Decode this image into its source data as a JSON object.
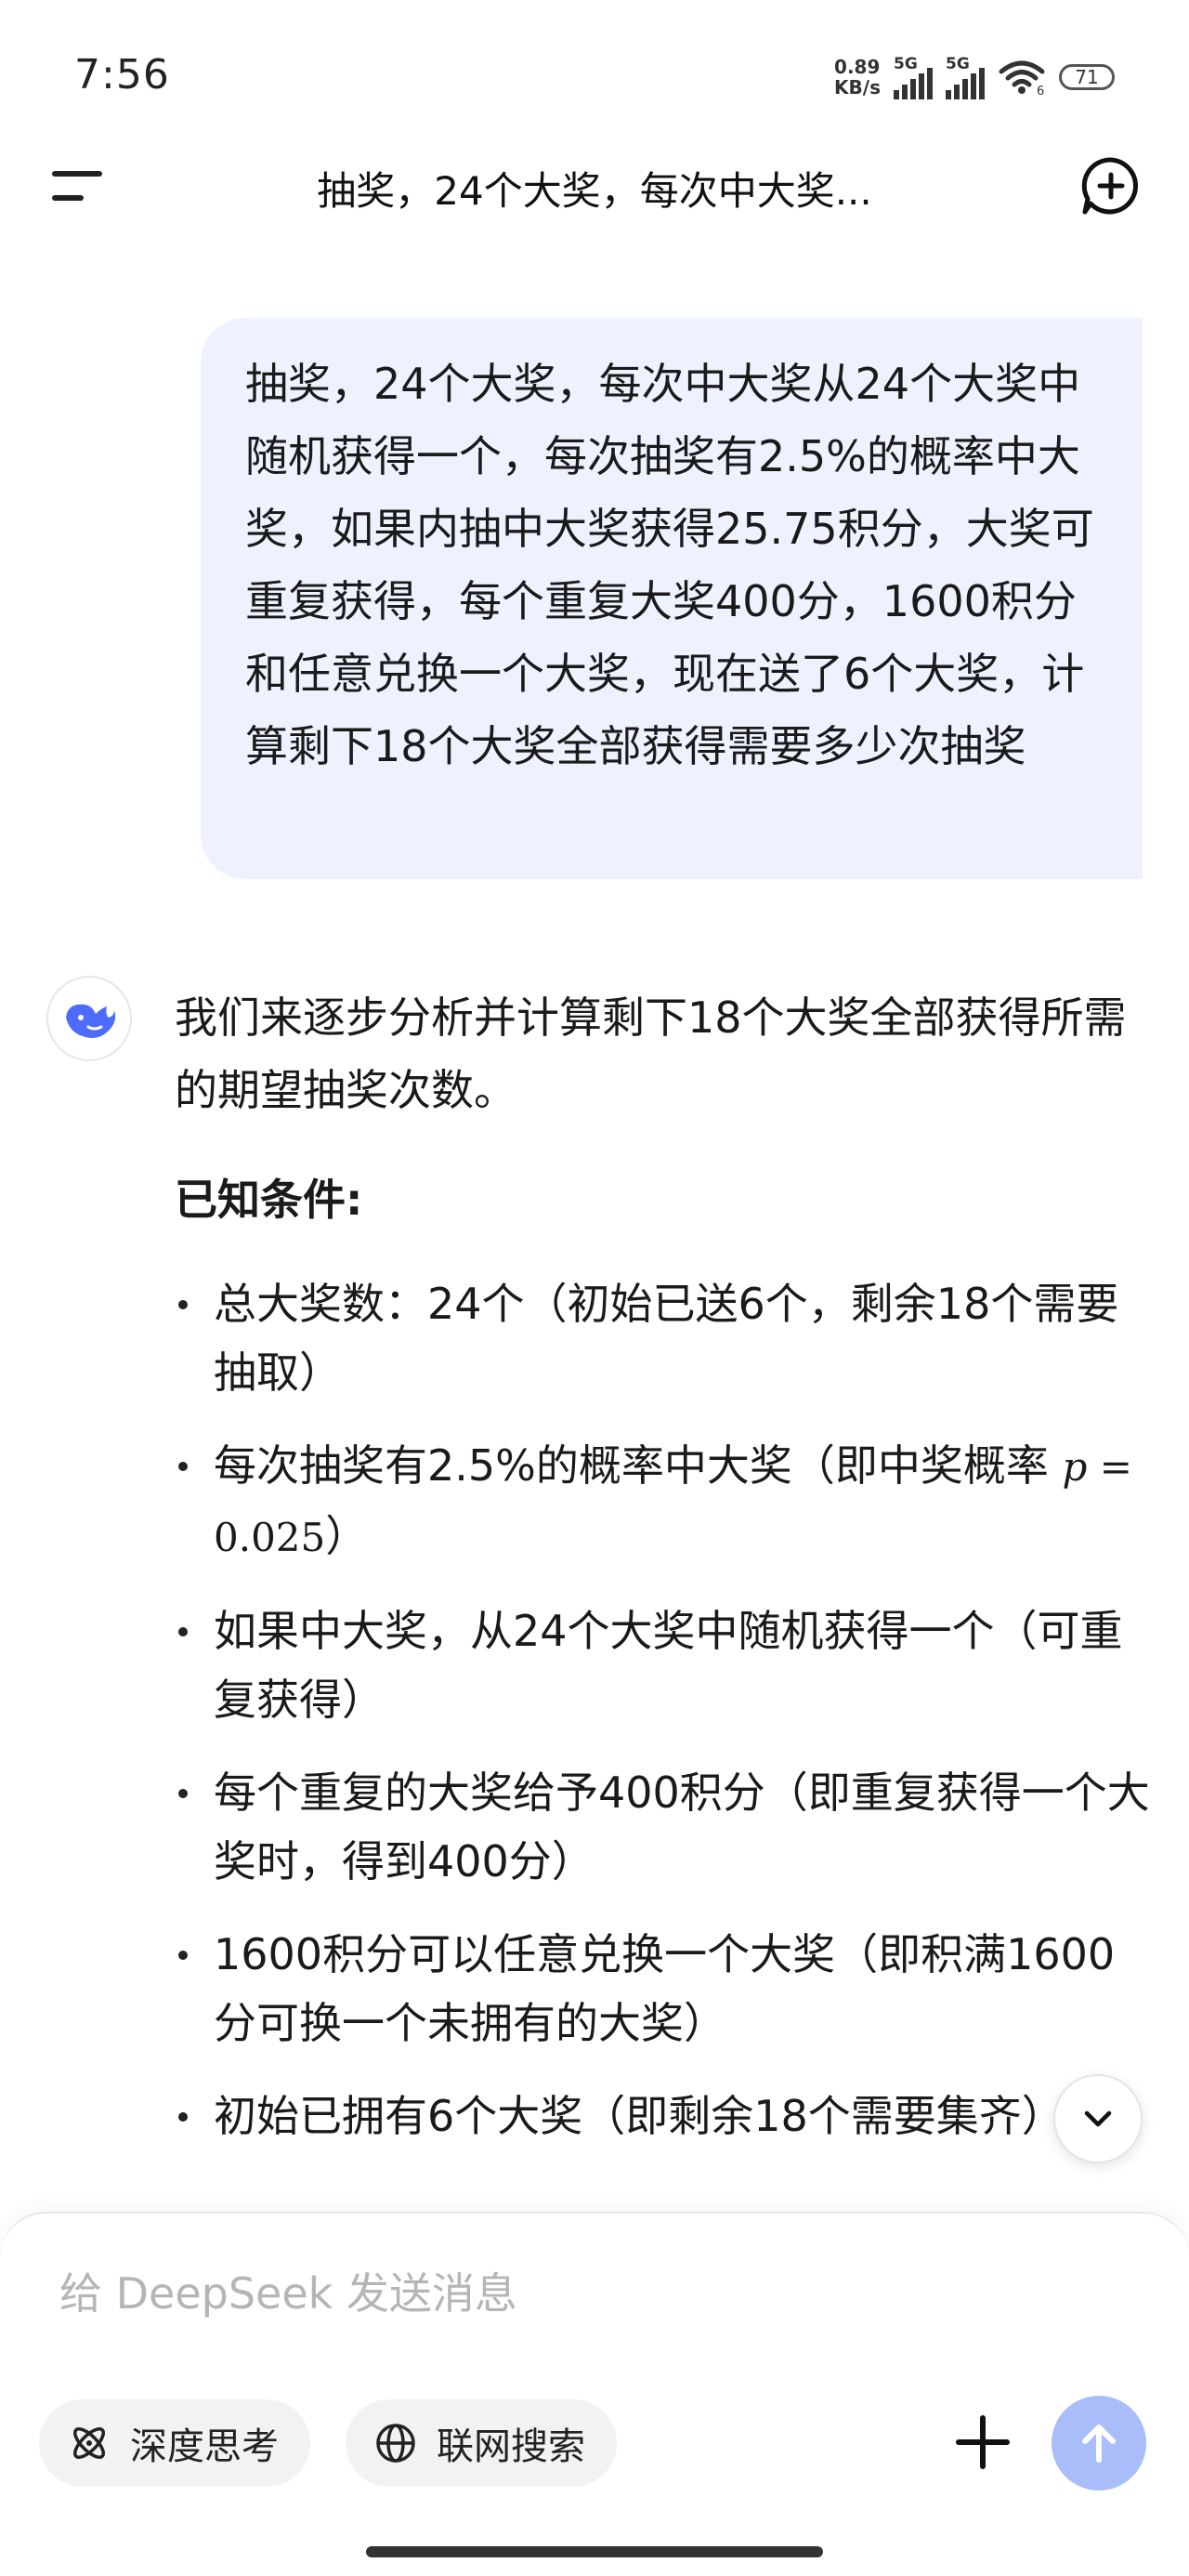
{
  "status_bar": {
    "time": "7:56",
    "net_speed_value": "0.89",
    "net_speed_unit": "KB/s",
    "signal1_label": "5G",
    "signal2_label": "5G",
    "wifi_label": "6",
    "battery": "71"
  },
  "header": {
    "title": "抽奖，24个大奖，每次中大奖..."
  },
  "user_message": {
    "text": "抽奖，24个大奖，每次中大奖从24个大奖中随机获得一个，每次抽奖有2.5%的概率中大奖，如果内抽中大奖获得25.75积分，大奖可重复获得，每个重复大奖400分，1600积分和任意兑换一个大奖，现在送了6个大奖，计算剩下18个大奖全部获得需要多少次抽奖"
  },
  "assistant": {
    "intro": "我们来逐步分析并计算剩下18个大奖全部获得所需的期望抽奖次数。",
    "heading": "已知条件:",
    "bullets": [
      "总大奖数：24个（初始已送6个，剩余18个需要抽取）",
      "每次抽奖有2.5%的概率中大奖（即中奖概率",
      "如果中大奖，从24个大奖中随机获得一个（可重复获得）",
      "每个重复的大奖给予400积分（即重复获得一个大奖时，得到400分）",
      "1600积分可以任意兑换一个大奖（即积满1600分可换一个未拥有的大奖）",
      "初始已拥有6个大奖（即剩余18个需要集齐）"
    ],
    "math_var": "p",
    "math_eq": " = 0.025",
    "math_close": "）"
  },
  "composer": {
    "placeholder": "给 DeepSeek 发送消息",
    "deep_think_label": "深度思考",
    "web_search_label": "联网搜索"
  },
  "colors": {
    "user_bubble_bg": "#eef2fe",
    "accent": "#4d6bfe",
    "send_button_bg": "#a9bdfb",
    "pill_bg": "#f2f2f2"
  },
  "icons": [
    "menu-icon",
    "new-chat-icon",
    "deepseek-whale-icon",
    "chevron-down-icon",
    "atom-icon",
    "globe-icon",
    "plus-icon",
    "arrow-up-icon",
    "wifi-icon",
    "signal-icon",
    "battery-icon"
  ]
}
